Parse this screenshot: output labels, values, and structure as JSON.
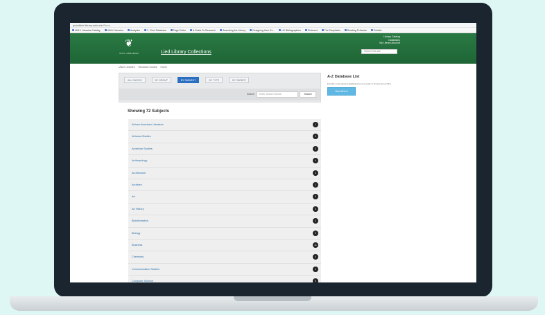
{
  "browser": {
    "url": "quidditch.library.unlv.edu/?v=s",
    "bookmarks": [
      "UNLV Libraries Catalog",
      "UNLV Libraries",
      "Analytics",
      "1. Find. Database",
      "Page Editor",
      "A Guide To Research",
      "Searching the Library",
      "Designing User Ex...",
      "UX Bibliographies",
      "Pinterest",
      "The Templates",
      "Reading Fl Assets",
      "Publish"
    ]
  },
  "site": {
    "logo_text": "UNIV LIBRARIES",
    "title": "Lied Library Collections",
    "header_links": [
      "Library Catalog",
      "Databases",
      "My Library Account"
    ],
    "search_placeholder": "Search this site"
  },
  "breadcrumb": [
    "UNLV Libraries",
    "Research Guides",
    "Home"
  ],
  "filter": {
    "tabs": [
      {
        "label": "ALL GUIDES",
        "active": false
      },
      {
        "label": "BY GROUP",
        "active": false
      },
      {
        "label": "BY SUBJECT",
        "active": true
      },
      {
        "label": "BY TYPE",
        "active": false
      },
      {
        "label": "BY OWNER",
        "active": false
      }
    ],
    "search_label": "Search",
    "search_placeholder": "Enter Search Words",
    "search_button": "Search"
  },
  "az": {
    "title": "A-Z Database List",
    "description": "Find the most relevant databases for your topic or browse the A-Z list.",
    "button": "View All A-Z"
  },
  "subjects": {
    "heading": "Showing 72 Subjects",
    "items": [
      {
        "name": "African American Literature",
        "count": "1"
      },
      {
        "name": "Africana Studies",
        "count": "4"
      },
      {
        "name": "American Studies",
        "count": "3"
      },
      {
        "name": "Anthropology",
        "count": "4"
      },
      {
        "name": "Architecture",
        "count": "4"
      },
      {
        "name": "Archives",
        "count": "1"
      },
      {
        "name": "Art",
        "count": "4"
      },
      {
        "name": "Art History",
        "count": "4"
      },
      {
        "name": "Bioinformatics",
        "count": "1"
      },
      {
        "name": "Biology",
        "count": "2"
      },
      {
        "name": "Business",
        "count": "11"
      },
      {
        "name": "Chemistry",
        "count": "4"
      },
      {
        "name": "Communication Studies",
        "count": "4"
      },
      {
        "name": "Computer Science",
        "count": "3"
      }
    ]
  }
}
